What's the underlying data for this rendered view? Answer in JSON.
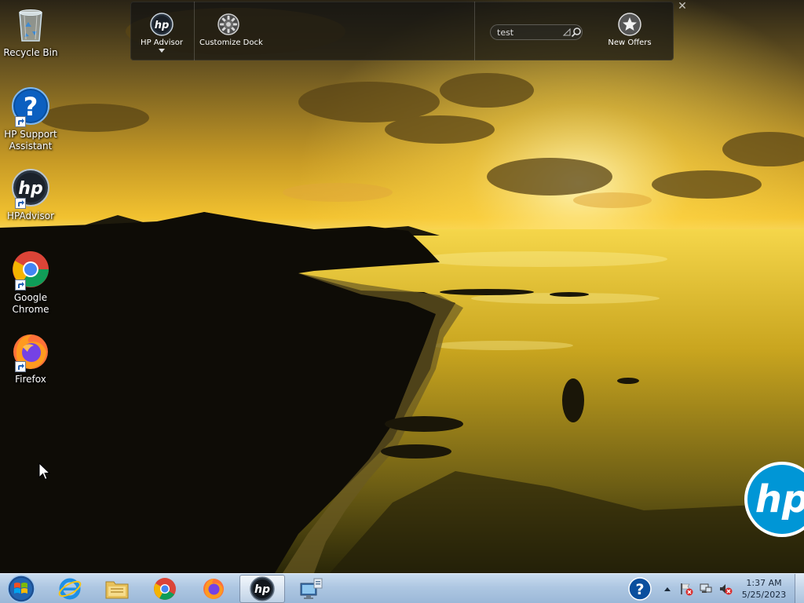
{
  "desktop": {
    "icons": [
      {
        "label": "Recycle Bin",
        "icon": "recycle-bin-icon"
      },
      {
        "label": "HP Support Assistant",
        "icon": "hp-support-assistant-icon"
      },
      {
        "label": "HPAdvisor",
        "icon": "hp-advisor-icon"
      },
      {
        "label": "Google Chrome",
        "icon": "chrome-icon"
      },
      {
        "label": "Firefox",
        "icon": "firefox-icon"
      }
    ]
  },
  "dock": {
    "hp_advisor_label": "HP Advisor",
    "customize_label": "Customize Dock",
    "search_value": "test",
    "new_offers_label": "New Offers",
    "close_glyph": "✕"
  },
  "taskbar": {
    "pinned": [
      {
        "icon": "internet-explorer-icon"
      },
      {
        "icon": "file-explorer-icon"
      },
      {
        "icon": "chrome-icon"
      },
      {
        "icon": "firefox-icon"
      },
      {
        "icon": "hp-advisor-icon",
        "active": true
      },
      {
        "icon": "network-setup-icon"
      }
    ],
    "clock_time": "1:37 AM",
    "clock_date": "5/25/2023"
  },
  "colors": {
    "hp_blue": "#0096d6",
    "taskbar": "#aec7e2",
    "sky_gold": "#f2c230"
  }
}
